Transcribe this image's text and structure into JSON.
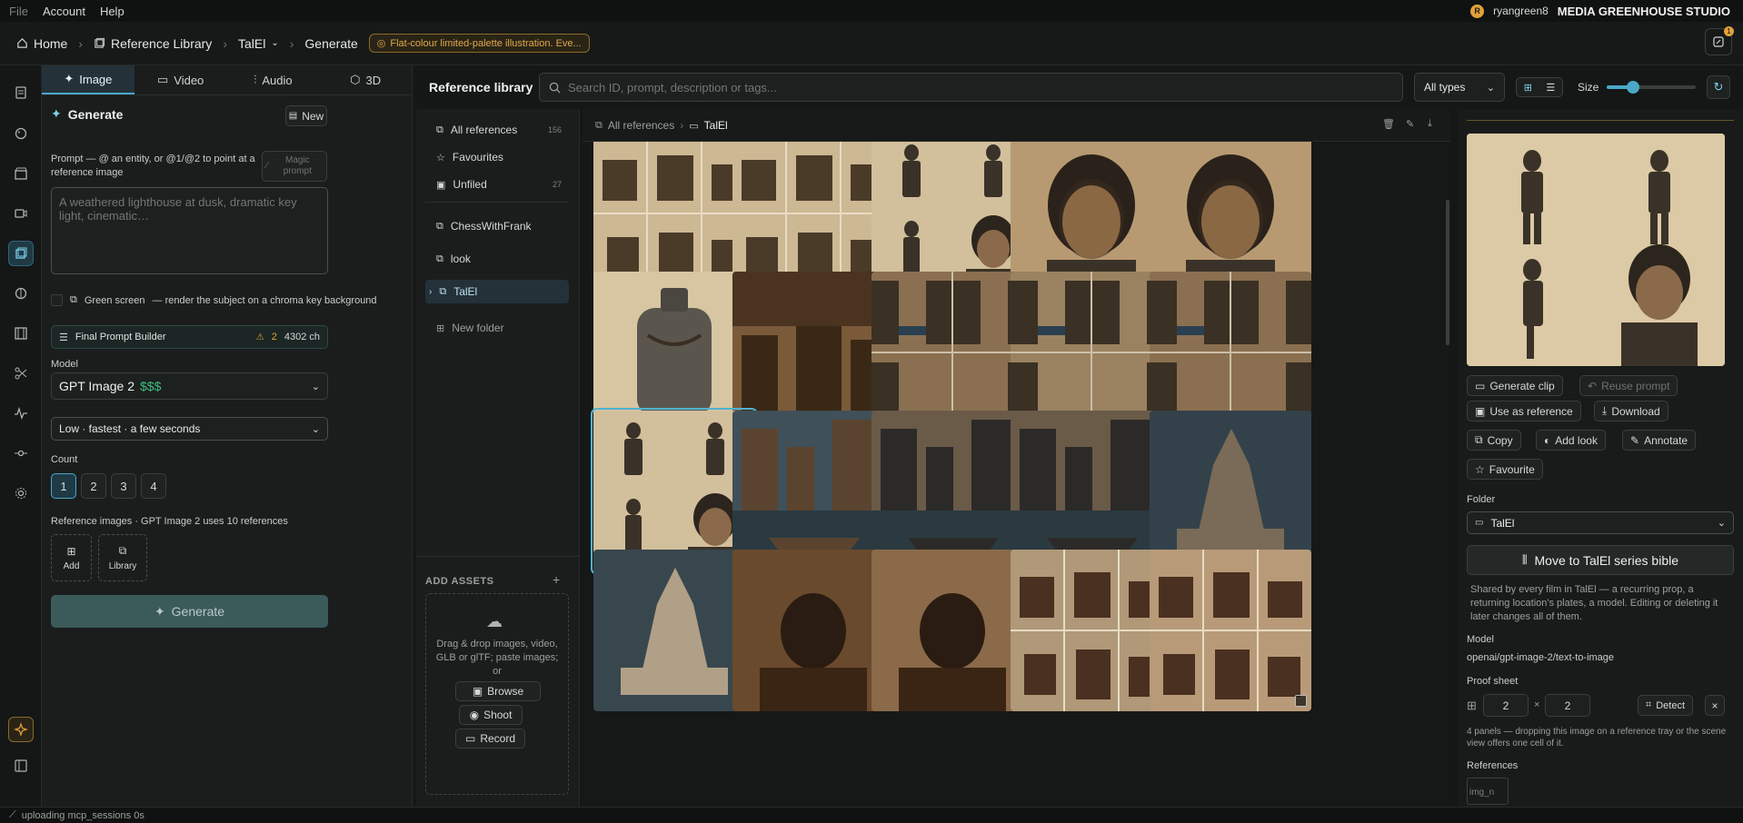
{
  "menu": {
    "file": "File",
    "account": "Account",
    "help": "Help"
  },
  "user": {
    "initial": "R",
    "name": "ryangreen8",
    "studio": "MEDIA GREENHOUSE STUDIO"
  },
  "breadcrumb": {
    "home": "Home",
    "library": "Reference Library",
    "project": "TalEl",
    "page": "Generate",
    "prompt_pill": "Flat-colour limited-palette illustration. Eve..."
  },
  "notifications": {
    "count": "1"
  },
  "generate_panel": {
    "tabs": [
      "Image",
      "Video",
      "Audio",
      "3D"
    ],
    "title": "Generate",
    "new_label": "New",
    "prompt_label": "Prompt — @ an entity, or @1/@2 to point at a reference image",
    "magic_prompt": "Magic prompt",
    "prompt_placeholder": "A weathered lighthouse at dusk, dramatic key light, cinematic…",
    "green_screen_label": "Green screen",
    "green_screen_hint": "— render the subject on a chroma key background",
    "final_prompt_builder": "Final Prompt Builder",
    "warning_count": "2",
    "char_count": "4302 ch",
    "model_label": "Model",
    "model_value": "GPT Image 2",
    "model_cost": "$$$",
    "quality_value": "Low · fastest · a few seconds",
    "count_label": "Count",
    "counts": [
      "1",
      "2",
      "3",
      "4"
    ],
    "count_selected": "1",
    "ref_images_label": "Reference images · GPT Image 2 uses 10 references",
    "add_label": "Add",
    "library_label": "Library",
    "generate_button": "Generate"
  },
  "library": {
    "title": "Reference library",
    "search_placeholder": "Search ID, prompt, description or tags...",
    "type_filter": "All types",
    "size_label": "Size",
    "size_value": 0.3,
    "folders": [
      {
        "label": "All references",
        "count": "156"
      },
      {
        "label": "Favourites",
        "count": ""
      },
      {
        "label": "Unfiled",
        "count": "27"
      },
      {
        "label": "ChessWithFrank",
        "count": ""
      },
      {
        "label": "look",
        "count": ""
      },
      {
        "label": "TalEl",
        "count": ""
      }
    ],
    "new_folder": "New folder",
    "add_assets_title": "ADD ASSETS",
    "add_assets_text": "Drag & drop images, video, GLB or glTF; paste images; or",
    "browse": "Browse",
    "shoot": "Shoot",
    "record": "Record",
    "path_root": "All references",
    "path_folder": "TalEl"
  },
  "detail": {
    "generate_clip": "Generate clip",
    "reuse_prompt": "Reuse prompt",
    "use_as_reference": "Use as reference",
    "download": "Download",
    "copy": "Copy",
    "add_look": "Add look",
    "annotate": "Annotate",
    "favourite": "Favourite",
    "folder_label": "Folder",
    "folder_value": "TalEl",
    "move_button": "Move to TalEl series bible",
    "shared_text": "Shared by every film in TalEl — a recurring prop, a returning location's plates, a model. Editing or deleting it later changes all of them.",
    "model_label": "Model",
    "model_value": "openai/gpt-image-2/text-to-image",
    "proof_label": "Proof sheet",
    "proof_cols": "2",
    "proof_x": "×",
    "proof_rows": "2",
    "detect": "Detect",
    "proof_hint": "4 panels — dropping this image on a reference tray or the scene view offers one cell of it.",
    "references_label": "References",
    "ref_alt": "img_n"
  },
  "status": {
    "text": "uploading mcp_sessions 0s"
  },
  "colors": {
    "accent": "#4aa8c8",
    "warning": "#e2a13a",
    "cost": "#3fbf7f"
  }
}
